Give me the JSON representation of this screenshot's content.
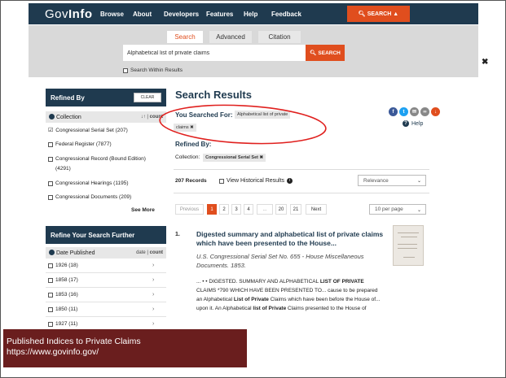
{
  "nav": {
    "logo_part1": "Gov",
    "logo_part2": "Info",
    "links": [
      "Browse",
      "About",
      "Developers",
      "Features",
      "Help",
      "Feedback"
    ],
    "search_button": "SEARCH"
  },
  "search": {
    "tabs": [
      "Search",
      "Advanced",
      "Citation"
    ],
    "active_tab": "Search",
    "query": "Alphabetical list of private claims",
    "button": "SEARCH",
    "within_label": "Search Within Results"
  },
  "sidebar": {
    "refined_by": "Refined By",
    "clear": "CLEAR",
    "collection_header": "Collection",
    "collection_sort": "count",
    "collections": [
      {
        "label": "Congressional Serial Set (207)",
        "checked": true
      },
      {
        "label": "Federal Register (7877)",
        "checked": false
      },
      {
        "label": "Congressional Record (Bound Edition)",
        "checked": false
      },
      {
        "label": "(4291)",
        "checked": false
      },
      {
        "label": "Congressional Hearings (1195)",
        "checked": false
      },
      {
        "label": "Congressional Documents (209)",
        "checked": false
      }
    ],
    "see_more": "See More",
    "refine_further": "Refine Your Search Further",
    "date_header": "Date Published",
    "date_sort_1": "date",
    "date_sort_2": "count",
    "dates": [
      "1926 (18)",
      "1858 (17)",
      "1853 (16)",
      "1850 (11)",
      "1927 (11)"
    ]
  },
  "results": {
    "title": "Search Results",
    "you_searched": "You Searched For:",
    "query_chip_1": "Alphabetical list of private",
    "query_chip_2": "claims ✖",
    "refined_by": "Refined By:",
    "collection_label": "Collection:",
    "collection_chip": "Congressional Serial Set ✖",
    "records": "207 Records",
    "historical": "View Historical Results",
    "sort": "Relevance",
    "per_page": "10 per page",
    "pages": [
      "Previous",
      "1",
      "2",
      "3",
      "4",
      "...",
      "20",
      "21",
      "Next"
    ],
    "help": "Help",
    "item": {
      "number": "1.",
      "title": "Digested summary and alphabetical list of private claims which have been presented to the House...",
      "subtitle": "U.S. Congressional Serial Set No. 655 - House Miscellaneous Documents. 1853.",
      "snippet_1": "... • • DIGESTED. SUMMARY AND ALPHABETICAL ",
      "snippet_b1": "LIST OF PRIVATE",
      "snippet_2": " CLAIMS *790 WHICH HAVE BEEN PRESENTED TO... cause to be prepared an Alphabetical ",
      "snippet_b2": "List of Private",
      "snippet_3": " Claims which have been before the House of... upon it. An Alphabetical ",
      "snippet_b3": "list of Private",
      "snippet_4": " Claims presented to the House of"
    }
  },
  "caption": {
    "line1": "Published Indices to Private Claims",
    "line2": "https://www.govinfo.gov/"
  },
  "colors": {
    "navy": "#1f3a4f",
    "accent": "#e04e1e",
    "caption_bg": "#6a1e1e",
    "annotation": "#e0201e"
  }
}
